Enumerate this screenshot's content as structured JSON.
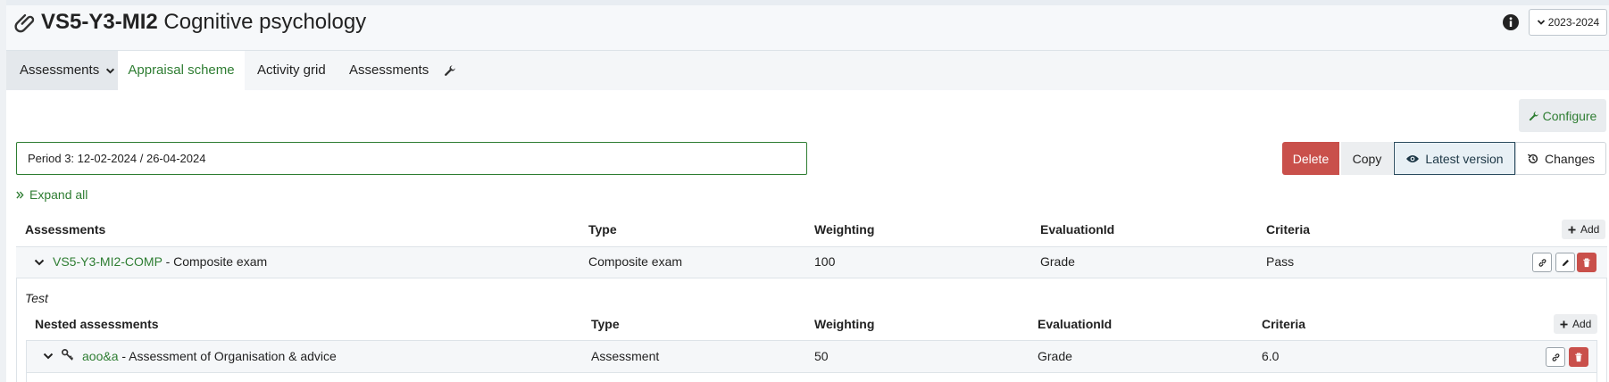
{
  "header": {
    "code": "VS5-Y3-MI2",
    "name": "Cognitive psychology",
    "year_selector": "2023-2024"
  },
  "tabs": [
    {
      "label": "Assessments"
    },
    {
      "label": "Appraisal scheme"
    },
    {
      "label": "Activity grid"
    },
    {
      "label": "Assessments"
    }
  ],
  "toolbar": {
    "configure_label": "Configure",
    "delete_label": "Delete",
    "copy_label": "Copy",
    "latest_label": "Latest version",
    "changes_label": "Changes"
  },
  "period": {
    "value": "Period 3: 12-02-2024 / 26-04-2024"
  },
  "expand_all_label": "Expand all",
  "table": {
    "columns": [
      "Assessments",
      "Type",
      "Weighting",
      "EvaluationId",
      "Criteria"
    ],
    "add_label": "Add",
    "rows": [
      {
        "code": "VS5-Y3-MI2-COMP",
        "name": "- Composite exam",
        "type": "Composite exam",
        "weighting": "100",
        "evaluation": "Grade",
        "criteria": "Pass"
      }
    ]
  },
  "nested": {
    "group_label": "Test",
    "columns": [
      "Nested assessments",
      "Type",
      "Weighting",
      "EvaluationId",
      "Criteria"
    ],
    "add_label": "Add",
    "rows": [
      {
        "code": "aoo&a",
        "name": "- Assessment of Organisation & advice",
        "type": "Assessment",
        "weighting": "50",
        "evaluation": "Grade",
        "criteria": "6.0"
      }
    ]
  },
  "colors": {
    "accent_green": "#2e7d32",
    "danger_red": "#c9504b",
    "header_bg": "#f6f8fa"
  },
  "icons": [
    "paperclip-icon",
    "info-icon",
    "chevron-down-icon",
    "wrench-icon",
    "eye-icon",
    "history-icon",
    "double-chevron-right-icon",
    "plus-icon",
    "link-icon",
    "pencil-icon",
    "trash-icon",
    "key-icon"
  ]
}
